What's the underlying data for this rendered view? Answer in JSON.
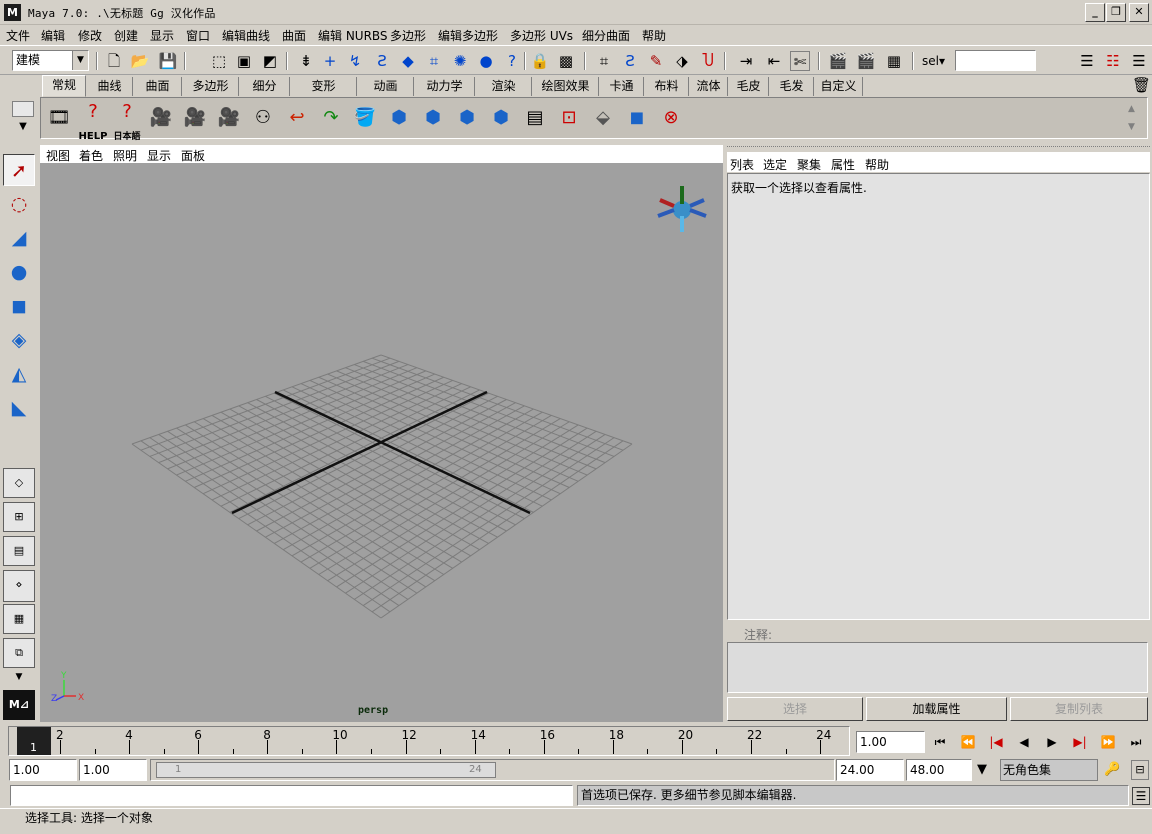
{
  "window": {
    "title": "Maya 7.0: .\\无标题  Gg 汉化作品",
    "logo": "M",
    "buttons": {
      "minimize": "_",
      "maximize": "❐",
      "close": "✕"
    }
  },
  "menubar": [
    "文件",
    "编辑",
    "修改",
    "创建",
    "显示",
    "窗口",
    "编辑曲线",
    "曲面",
    "编辑 NURBS",
    "多边形",
    "编辑多边形",
    "多边形 UVs",
    "细分曲面",
    "帮助"
  ],
  "toolbar": {
    "menu_set": "建模",
    "select_label": "sel▾",
    "select_value": ""
  },
  "shelf": {
    "tabs": [
      "常规",
      "曲线",
      "曲面",
      "多边形",
      "细分",
      "变形",
      "动画",
      "动力学",
      "渲染",
      "绘图效果",
      "卡通",
      "布料",
      "流体",
      "毛皮",
      "毛发",
      "自定义"
    ],
    "active_tab": "常规",
    "help_labels": {
      "help": "HELP",
      "japanese": "日本語"
    }
  },
  "viewport": {
    "menu": [
      "视图",
      "着色",
      "照明",
      "显示",
      "面板"
    ],
    "camera": "persp",
    "axis": {
      "y": "Y",
      "z": "Z",
      "x": "X"
    }
  },
  "attribute_editor": {
    "menu": [
      "列表",
      "选定",
      "聚集",
      "属性",
      "帮助"
    ],
    "message": "获取一个选择以查看属性.",
    "notes_label": "注释:",
    "buttons": {
      "select": "选择",
      "load": "加载属性",
      "copy": "复制列表"
    }
  },
  "timeline": {
    "current_frame": "1",
    "tick_labels": [
      "2",
      "4",
      "6",
      "8",
      "10",
      "12",
      "14",
      "16",
      "18",
      "20",
      "22",
      "24"
    ],
    "current_time": "1.00"
  },
  "range": {
    "start_time": "1.00",
    "playback_start": "1.00",
    "thumb_start": "1",
    "thumb_end": "24",
    "playback_end": "24.00",
    "end_time": "48.00",
    "character_set": "无角色集"
  },
  "command": {
    "input": "",
    "result": "首选项已保存. 更多细节参见脚本编辑器."
  },
  "help_line": "选择工具: 选择一个对象",
  "colors": {
    "background": "#d4d0c8",
    "viewport": "#a0a0a0"
  }
}
